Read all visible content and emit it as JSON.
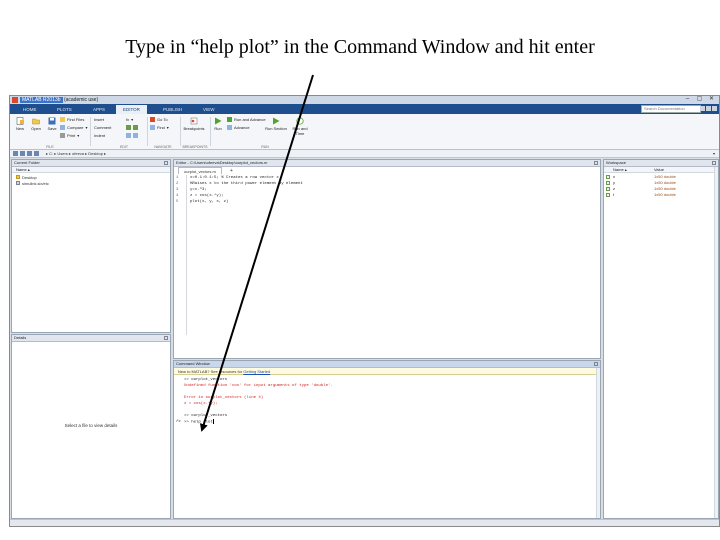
{
  "slide": {
    "instruction": "Type in “help plot” in the Command Window and hit enter"
  },
  "window": {
    "title_app": "MATLAB R2013b",
    "title_doc": "(academic use)",
    "min": "–",
    "max": "▢",
    "close": "✕"
  },
  "ribbon_tabs": [
    {
      "label": "HOME",
      "active": false
    },
    {
      "label": "PLOTS",
      "active": false
    },
    {
      "label": "APPS",
      "active": false
    },
    {
      "label": "EDITOR",
      "active": true
    },
    {
      "label": "PUBLISH",
      "active": false
    },
    {
      "label": "VIEW",
      "active": false
    }
  ],
  "search": {
    "placeholder": "Search Documentation"
  },
  "ribbon": {
    "new": "New",
    "open": "Open",
    "save": "Save",
    "find_files": "Find Files",
    "compare": "Compare",
    "print": "Print",
    "insert": "Insert",
    "go_to": "Go To",
    "comment": "Comment",
    "find": "Find",
    "indent": "Indent",
    "breakpoints": "Breakpoints",
    "run": "Run",
    "run_and_advance": "Run and Advance",
    "run_section": "Run Section",
    "advance": "Advance",
    "run_and_time": "Run and Time",
    "group_file": "FILE",
    "group_edit": "EDIT",
    "group_nav": "NAVIGATE",
    "group_bp": "BREAKPOINTS",
    "group_run": "RUN"
  },
  "address": {
    "path": "▸ C: ▸ Users ▸ ofeeva ▸ Desktop ▸",
    "arrow": "▾"
  },
  "current_folder": {
    "title": "Current Folder",
    "col_name": "Name ▴",
    "items": [
      "Desktop",
      "simulink.slx/etc"
    ],
    "details_title": "Details",
    "details_msg": "Select a file to view details"
  },
  "editor": {
    "title": "Editor - C:\\Users\\ofeeva\\Desktop\\ourplot_vectors.m",
    "tab": "ourplot_vectors.m",
    "add_tab": "+",
    "lines": [
      {
        "n": "1",
        "code": "x=0.1:0.1:5; % Creates a row vector x"
      },
      {
        "n": "2",
        "code": "%Raises x to the third power element by element"
      },
      {
        "n": "3",
        "code": "y=x.^3;"
      },
      {
        "n": "4",
        "code": "z = cos(x.*y);"
      },
      {
        "n": "5",
        "code": "plot(x, y, x, z)"
      }
    ]
  },
  "command_window": {
    "title": "Command Window",
    "info_text": "New to MATLAB? See resources for ",
    "info_link": "Getting Started",
    "lines": [
      {
        "text": ">> ourplot_vectors",
        "err": false
      },
      {
        "text": "Undefined function 'cos' for input arguments of type 'double'.",
        "err": true
      },
      {
        "text": "",
        "err": false
      },
      {
        "text": "Error in ourplot_vectors (line 4)",
        "err": true
      },
      {
        "text": "z = cos(x.*y);",
        "err": true
      },
      {
        "text": "",
        "err": false
      },
      {
        "text": ">> ourplot_vectors",
        "err": false
      },
      {
        "text": ">> help plot",
        "err": false,
        "prompt": true
      }
    ],
    "fx": "fx"
  },
  "workspace": {
    "title": "Workspace",
    "col_name": "Name ▴",
    "col_value": "Value",
    "vars": [
      {
        "name": "x",
        "value": "1x50 double"
      },
      {
        "name": "y",
        "value": "1x50 double"
      },
      {
        "name": "z",
        "value": "1x50 double"
      },
      {
        "name": "t",
        "value": "1x50 double"
      }
    ]
  },
  "colors": {
    "tabbar": "#1f4e8e",
    "error": "#d11a1a",
    "link": "#1a4fb5",
    "arrow": "#000000"
  }
}
